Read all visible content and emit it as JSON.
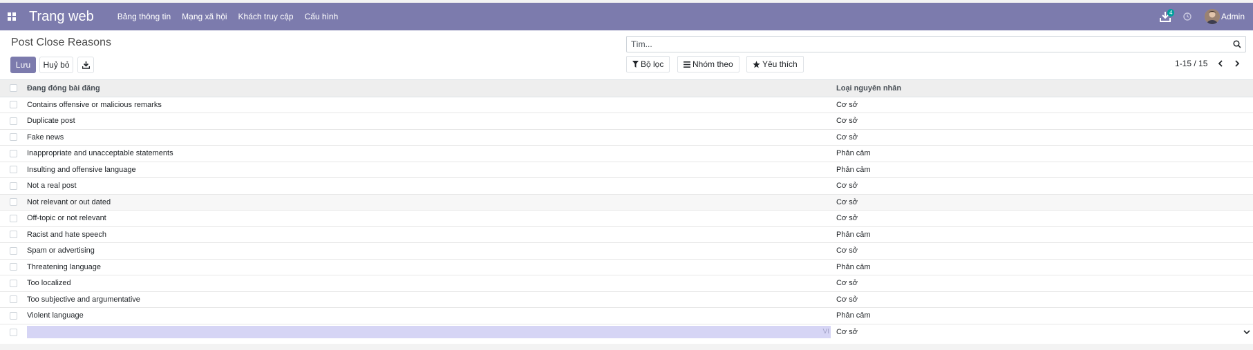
{
  "navbar": {
    "brand": "Trang web",
    "menu": [
      "Bảng thông tin",
      "Mạng xã hội",
      "Khách truy cập",
      "Cấu hình"
    ],
    "download_badge": "4",
    "user_name": "Admin",
    "color": "#7c7bad"
  },
  "control": {
    "title": "Post Close Reasons",
    "save_label": "Lưu",
    "discard_label": "Huỷ bỏ",
    "search_placeholder": "Tìm...",
    "filters_label": "Bộ lọc",
    "groupby_label": "Nhóm theo",
    "favorites_label": "Yêu thích",
    "pager_value": "1-15 / 15"
  },
  "table": {
    "columns": [
      "Đang đóng bài đăng",
      "Loại nguyên nhân"
    ],
    "rows": [
      {
        "name": "Contains offensive or malicious remarks",
        "type": "Cơ sở"
      },
      {
        "name": "Duplicate post",
        "type": "Cơ sở"
      },
      {
        "name": "Fake news",
        "type": "Cơ sở"
      },
      {
        "name": "Inappropriate and unacceptable statements",
        "type": "Phản cảm"
      },
      {
        "name": "Insulting and offensive language",
        "type": "Phản cảm"
      },
      {
        "name": "Not a real post",
        "type": "Cơ sở"
      },
      {
        "name": "Not relevant or out dated",
        "type": "Cơ sở"
      },
      {
        "name": "Off-topic or not relevant",
        "type": "Cơ sở"
      },
      {
        "name": "Racist and hate speech",
        "type": "Phản cảm"
      },
      {
        "name": "Spam or advertising",
        "type": "Cơ sở"
      },
      {
        "name": "Threatening language",
        "type": "Phản cảm"
      },
      {
        "name": "Too localized",
        "type": "Cơ sở"
      },
      {
        "name": "Too subjective and argumentative",
        "type": "Cơ sở"
      },
      {
        "name": "Violent language",
        "type": "Phản cảm"
      }
    ],
    "edit_row": {
      "lang_tag": "VI",
      "type_value": "Cơ sở"
    }
  }
}
